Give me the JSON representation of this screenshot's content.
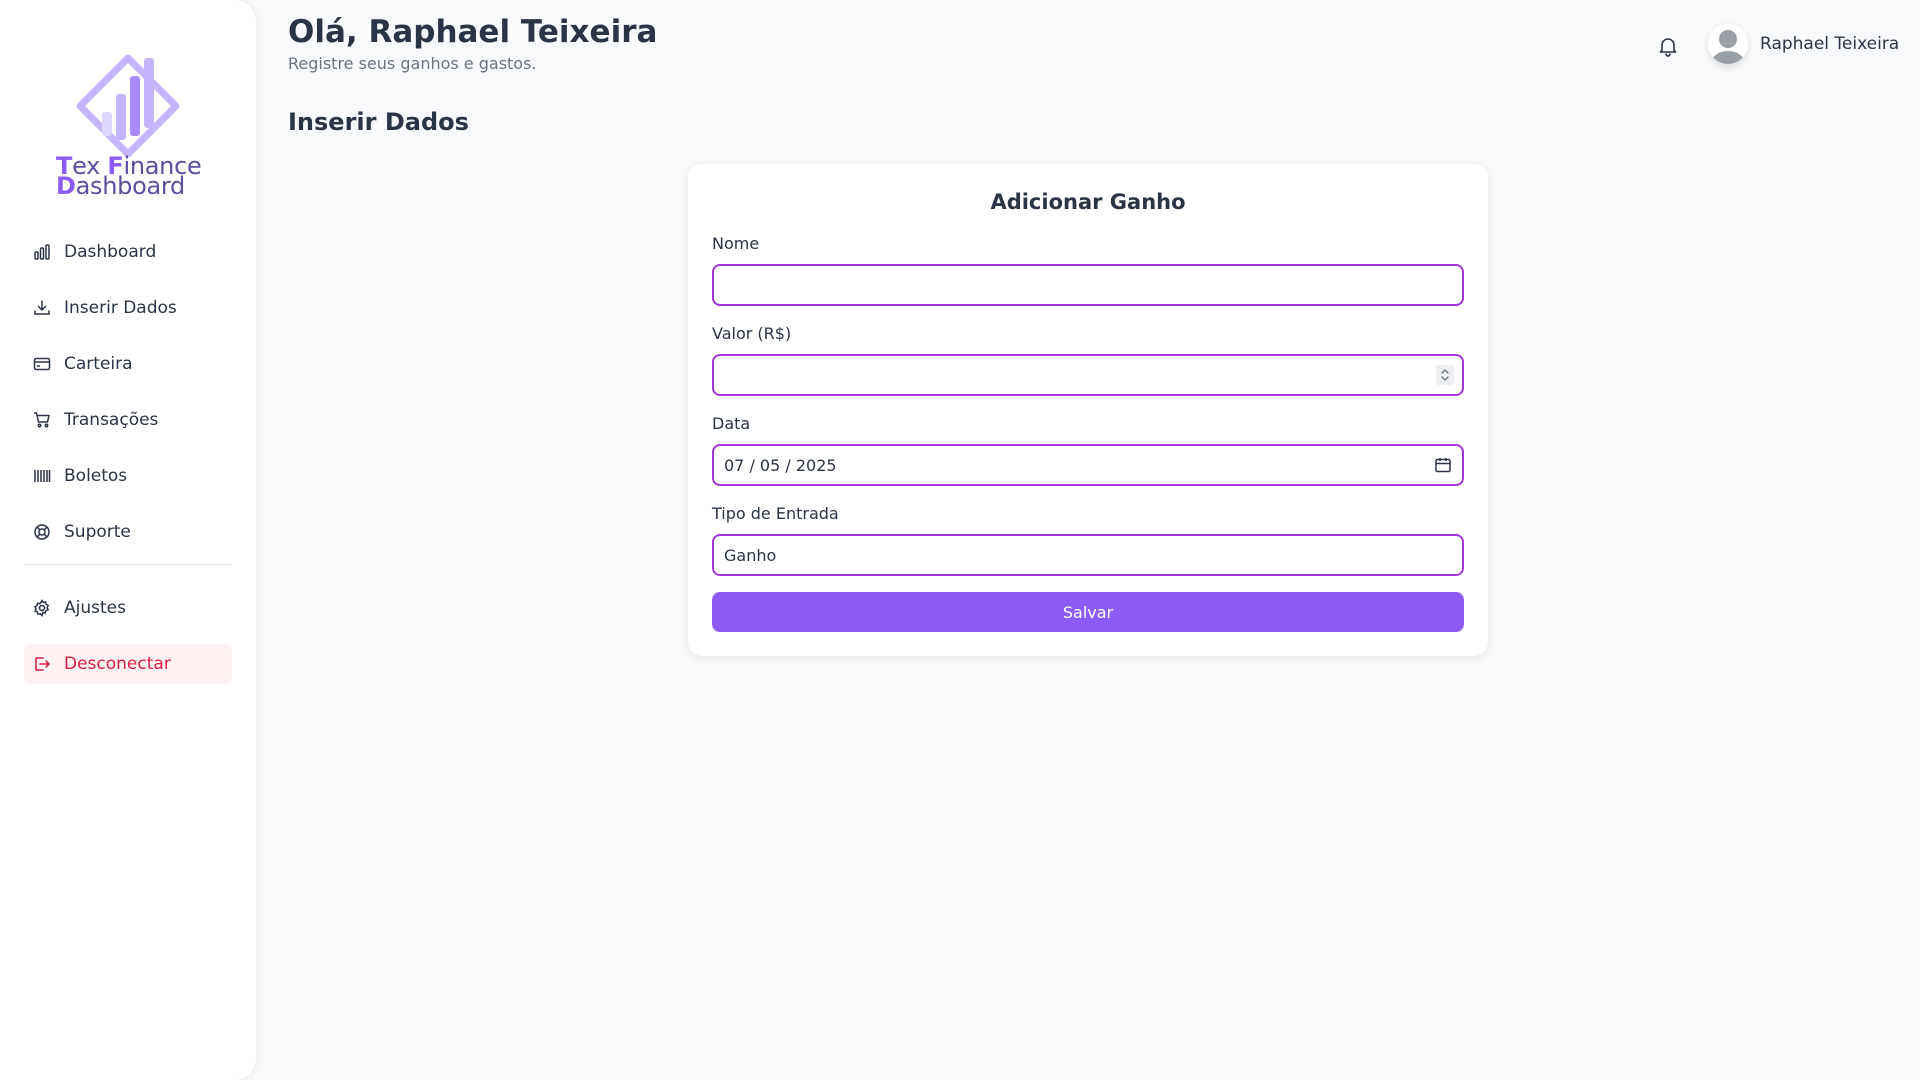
{
  "brand": {
    "line1_parts": [
      "T",
      "ex ",
      "F",
      "inance"
    ],
    "line2_parts": [
      "D",
      "ashboard"
    ],
    "accent": "#8b5cf6"
  },
  "sidebar": {
    "items": [
      {
        "label": "Dashboard",
        "icon": "bar-chart-icon"
      },
      {
        "label": "Inserir Dados",
        "icon": "download-icon"
      },
      {
        "label": "Carteira",
        "icon": "credit-card-icon"
      },
      {
        "label": "Transações",
        "icon": "shopping-cart-icon"
      },
      {
        "label": "Boletos",
        "icon": "barcode-icon"
      },
      {
        "label": "Suporte",
        "icon": "lifebuoy-icon"
      }
    ],
    "settings": {
      "label": "Ajustes",
      "icon": "gear-icon"
    },
    "logout": {
      "label": "Desconectar",
      "icon": "logout-icon",
      "color": "#d61f3d"
    }
  },
  "header": {
    "greeting": "Olá, Raphael Teixeira",
    "subtitle": "Registre seus ganhos e gastos.",
    "user_name": "Raphael Teixeira"
  },
  "main": {
    "section_title": "Inserir Dados",
    "form": {
      "title": "Adicionar Ganho",
      "name_label": "Nome",
      "name_value": "",
      "value_label": "Valor (R$)",
      "value_value": "",
      "date_label": "Data",
      "date_value": "07 / 05 / 2025",
      "type_label": "Tipo de Entrada",
      "type_value": "Ganho",
      "submit_label": "Salvar"
    }
  },
  "colors": {
    "primary": "#8b5cf6",
    "field_border": "#a334d6",
    "danger": "#d61f3d"
  }
}
